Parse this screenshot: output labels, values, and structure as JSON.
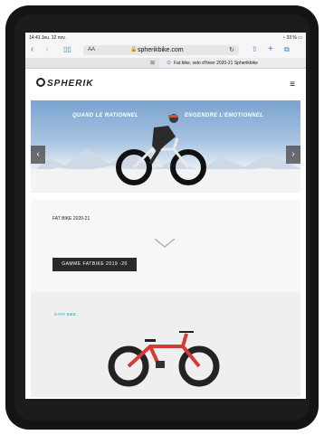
{
  "status_bar": {
    "time": "14:41  Jeu. 12 nov.",
    "battery": "33 %"
  },
  "browser": {
    "text_size_label": "AA",
    "url": "spherikbike.com",
    "tab_title": "Fat bike, velo d'hiver 2020-21 Spherikbike"
  },
  "site": {
    "logo_text": "SPHERIK",
    "hero": {
      "left_text": "QUAND LE RATIONNEL",
      "right_text": "ENGENDRE L'EMOTIONNEL"
    },
    "section1": {
      "title": "FAT BIKE 2020-21",
      "button_label": "GAMME FATBIKE 2019 -20"
    },
    "section2": {
      "label": "E-FAT BIKE"
    }
  },
  "colors": {
    "accent_blue": "#2a7cf0",
    "efat_label": "#1aa3d9",
    "bike_red": "#d63a35"
  }
}
